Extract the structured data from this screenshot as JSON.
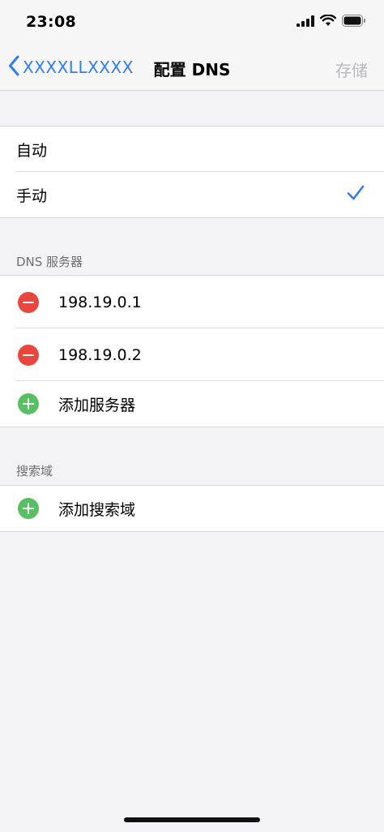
{
  "status_bar": {
    "time": "23:08"
  },
  "nav": {
    "back_label": "XXXXLLXXXX",
    "title": "配置 DNS",
    "save_label": "存储"
  },
  "mode_options": [
    {
      "label": "自动",
      "selected": false
    },
    {
      "label": "手动",
      "selected": true
    }
  ],
  "dns_section": {
    "header": "DNS 服务器",
    "servers": [
      "198.19.0.1",
      "198.19.0.2"
    ],
    "add_label": "添加服务器"
  },
  "search_section": {
    "header": "搜索域",
    "add_label": "添加搜索域"
  },
  "colors": {
    "accent": "#2f7cf6",
    "remove": "#e9473d",
    "add": "#57c062",
    "disabled": "#b8b8bd"
  }
}
